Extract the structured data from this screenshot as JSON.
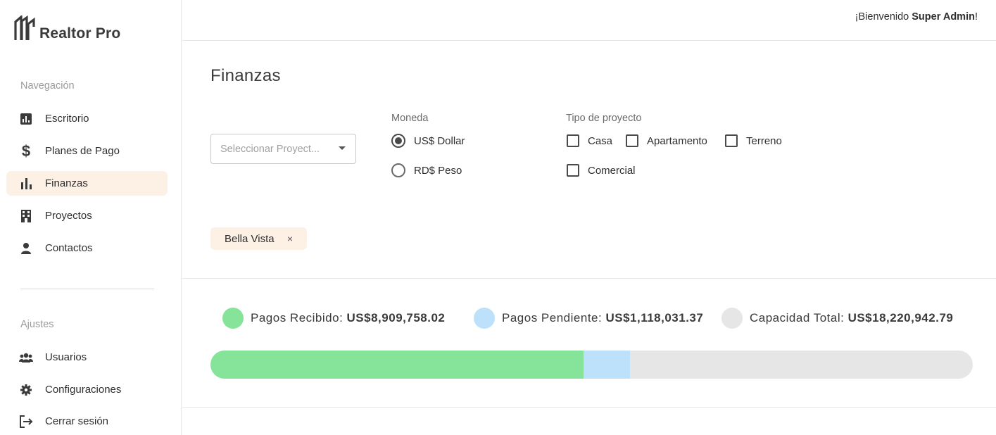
{
  "app": {
    "name": "Realtor Pro"
  },
  "header": {
    "welcome_prefix": "¡Bienvenido ",
    "user": "Super Admin",
    "welcome_suffix": "!"
  },
  "sidebar": {
    "nav_title": "Navegación",
    "nav_items": [
      {
        "label": "Escritorio",
        "icon": "chart-box-icon"
      },
      {
        "label": "Planes de Pago",
        "icon": "dollar-icon"
      },
      {
        "label": "Finanzas",
        "icon": "bar-chart-icon",
        "active": true
      },
      {
        "label": "Proyectos",
        "icon": "building-icon"
      },
      {
        "label": "Contactos",
        "icon": "person-icon"
      }
    ],
    "settings_title": "Ajustes",
    "settings_items": [
      {
        "label": "Usuarios",
        "icon": "users-icon"
      },
      {
        "label": "Configuraciones",
        "icon": "gear-icon"
      },
      {
        "label": "Cerrar sesión",
        "icon": "logout-icon"
      }
    ]
  },
  "main": {
    "title": "Finanzas",
    "project_select": {
      "placeholder": "Seleccionar Proyect..."
    },
    "currency": {
      "label": "Moneda",
      "options": [
        {
          "label": "US$ Dollar",
          "selected": true
        },
        {
          "label": "RD$ Peso",
          "selected": false
        }
      ]
    },
    "project_type": {
      "label": "Tipo de proyecto",
      "options": [
        {
          "label": "Casa",
          "checked": false
        },
        {
          "label": "Apartamento",
          "checked": false
        },
        {
          "label": "Terreno",
          "checked": false
        },
        {
          "label": "Comercial",
          "checked": false
        }
      ]
    },
    "selected_chip": {
      "label": "Bella Vista",
      "remove_icon": "×"
    }
  },
  "summary": {
    "received": {
      "label": "Pagos Recibido: ",
      "value": "US$8,909,758.02",
      "color": "#86e39a"
    },
    "pending": {
      "label": "Pagos Pendiente: ",
      "value": "US$1,118,031.37",
      "color": "#bde0fb"
    },
    "total": {
      "label": "Capacidad Total: ",
      "value": "US$18,220,942.79",
      "color": "#e6e6e6"
    }
  },
  "progress": {
    "received_fraction": 0.489,
    "pending_fraction": 0.0614
  }
}
